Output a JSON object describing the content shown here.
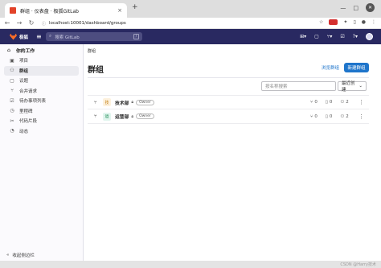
{
  "browser": {
    "tab_title": "群组 · 仪表盘 · 极狐GitLab",
    "tab_close": "×",
    "new_tab": "+",
    "win_min": "—",
    "win_max": "□",
    "win_close": "✕",
    "url": "localhost:10001/dashboard/groups"
  },
  "topnav": {
    "brand": "极狐",
    "search_placeholder": "搜索 GitLab",
    "search_shortcut": "/"
  },
  "sidebar": {
    "header": "你的工作",
    "items": [
      {
        "label": "项目",
        "icon": "project-icon",
        "active": false
      },
      {
        "label": "群组",
        "icon": "group-icon",
        "active": true
      },
      {
        "label": "议题",
        "icon": "issues-icon",
        "active": false
      },
      {
        "label": "合并请求",
        "icon": "merge-request-icon",
        "active": false
      },
      {
        "label": "待办事项列表",
        "icon": "todo-icon",
        "active": false
      },
      {
        "label": "里程碑",
        "icon": "milestone-icon",
        "active": false
      },
      {
        "label": "代码片段",
        "icon": "snippet-icon",
        "active": false
      },
      {
        "label": "动态",
        "icon": "activity-icon",
        "active": false
      }
    ],
    "collapse_label": "收起侧边栏"
  },
  "main": {
    "breadcrumb": "群组",
    "title": "群组",
    "explore_label": "浏览群组",
    "new_group_label": "新建群组",
    "filter_placeholder": "按名称搜索",
    "sort_label": "最近创建"
  },
  "groups": [
    {
      "initial": "技",
      "name": "技术部",
      "role": "Owner",
      "subgroups": "0",
      "projects": "0",
      "members": "2",
      "avatar_bg": "#fdf1dd",
      "avatar_fg": "#c17d10"
    },
    {
      "initial": "运",
      "name": "运营部",
      "role": "Owner",
      "subgroups": "0",
      "projects": "0",
      "members": "2",
      "avatar_bg": "#e1f5ee",
      "avatar_fg": "#108548"
    }
  ],
  "watermark": "CSDN @Harry技术"
}
